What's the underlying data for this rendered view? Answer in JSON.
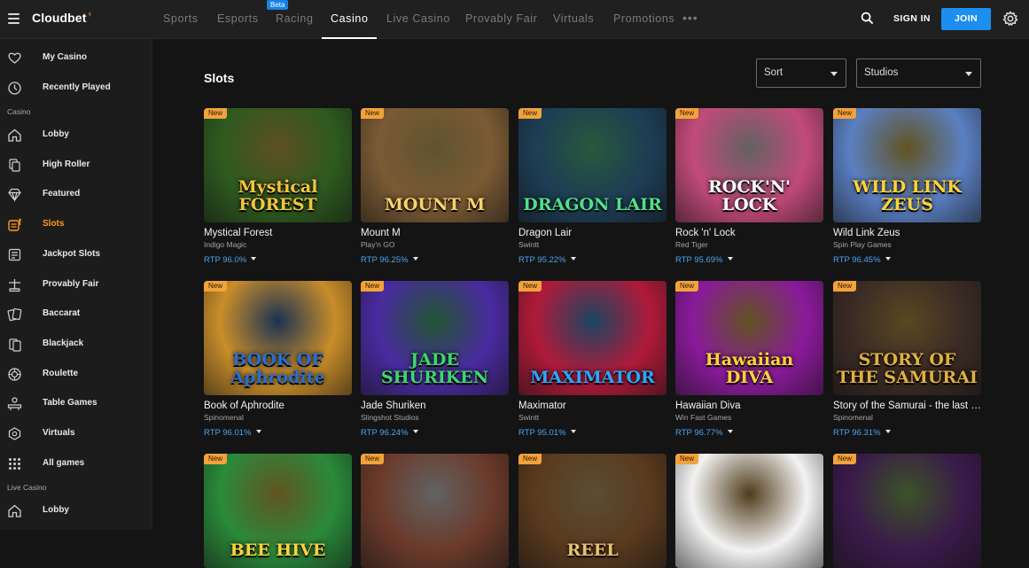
{
  "header": {
    "logo": "Cloudbet",
    "nav": [
      "Sports",
      "Esports",
      "Racing",
      "Casino",
      "Live Casino",
      "Provably Fair",
      "Virtuals",
      "Promotions"
    ],
    "active_nav": "Casino",
    "beta_label": "Beta",
    "more_icon": "more-dots-icon",
    "sign_in": "SIGN IN",
    "join": "JOIN",
    "icons": [
      "hamburger-menu-icon",
      "search-icon",
      "gear-icon"
    ]
  },
  "sidebar": {
    "top_items": [
      {
        "label": "My Casino",
        "icon": "heart-icon"
      },
      {
        "label": "Recently Played",
        "icon": "clock-icon"
      }
    ],
    "casino_section": "Casino",
    "casino_items": [
      {
        "label": "Lobby",
        "icon": "home-icon"
      },
      {
        "label": "High Roller",
        "icon": "chips-icon"
      },
      {
        "label": "Featured",
        "icon": "diamond-icon"
      },
      {
        "label": "Slots",
        "icon": "slot-machine-icon",
        "active": true
      },
      {
        "label": "Jackpot Slots",
        "icon": "jackpot-icon"
      },
      {
        "label": "Provably Fair",
        "icon": "scale-icon"
      },
      {
        "label": "Baccarat",
        "icon": "cards-icon"
      },
      {
        "label": "Blackjack",
        "icon": "blackjack-icon"
      },
      {
        "label": "Roulette",
        "icon": "roulette-icon"
      },
      {
        "label": "Table Games",
        "icon": "table-icon"
      },
      {
        "label": "Virtuals",
        "icon": "virtuals-icon"
      },
      {
        "label": "All games",
        "icon": "grid-icon"
      }
    ],
    "live_section": "Live Casino",
    "live_items": [
      {
        "label": "Lobby",
        "icon": "home-icon"
      }
    ],
    "active_color": "#ff9a1f"
  },
  "main": {
    "title": "Slots",
    "sort_label": "Sort",
    "studios_label": "Studios",
    "new_badge": "New",
    "games": [
      {
        "name": "Mystical Forest",
        "provider": "Indigo Magic",
        "rtp": "RTP 96.0%",
        "art": "Mystical FOREST",
        "bg": "#2e5a1f",
        "accent": "#f2c440"
      },
      {
        "name": "Mount M",
        "provider": "Play'n GO",
        "rtp": "RTP 96.25%",
        "art": "MOUNT M",
        "bg": "#7a5a34",
        "accent": "#f7d36a"
      },
      {
        "name": "Dragon Lair",
        "provider": "Swintt",
        "rtp": "RTP 95.22%",
        "art": "DRAGON LAIR",
        "bg": "#1d3d55",
        "accent": "#4fe08a"
      },
      {
        "name": "Rock 'n' Lock",
        "provider": "Red Tiger",
        "rtp": "RTP 95.69%",
        "art": "ROCK'N' LOCK",
        "bg": "#c24a7a",
        "accent": "#ffffff"
      },
      {
        "name": "Wild Link Zeus",
        "provider": "Spin Play Games",
        "rtp": "RTP 96.45%",
        "art": "WILD LINK ZEUS",
        "bg": "#5a7fc2",
        "accent": "#ffd23a"
      },
      {
        "name": "Book of Aphrodite",
        "provider": "Spinomenal",
        "rtp": "RTP 96.01%",
        "art": "BOOK OF Aphrodite",
        "bg": "#c98d2a",
        "accent": "#2a6fd1"
      },
      {
        "name": "Jade Shuriken",
        "provider": "Slingshot Studios",
        "rtp": "RTP 96.24%",
        "art": "JADE SHURIKEN",
        "bg": "#4a2aa0",
        "accent": "#3bd96b"
      },
      {
        "name": "Maximator",
        "provider": "Swintt",
        "rtp": "RTP 95.01%",
        "art": "MAXIMATOR",
        "bg": "#b01a3a",
        "accent": "#2aa8ff"
      },
      {
        "name": "Hawaiian Diva",
        "provider": "Win Fast Games",
        "rtp": "RTP 96.77%",
        "art": "Hawaiian DIVA",
        "bg": "#8a1a9a",
        "accent": "#ffd23a"
      },
      {
        "name": "Story of the Samurai - the last Ronin",
        "provider": "Spinomenal",
        "rtp": "RTP 96.31%",
        "art": "STORY OF THE SAMURAI",
        "bg": "#3a2a24",
        "accent": "#e0b040"
      },
      {
        "art": "BEE HIVE",
        "bg": "#2a8a3a",
        "accent": "#ffd23a"
      },
      {
        "art": "",
        "bg": "#6a3a2a",
        "accent": "#ffffff"
      },
      {
        "art": "REEL",
        "bg": "#5a3a1e",
        "accent": "#e8c070"
      },
      {
        "art": "",
        "bg": "#f2f2f2",
        "accent": "#c78a2a"
      },
      {
        "art": "",
        "bg": "#3a1a4a",
        "accent": "#8ad04a"
      }
    ]
  }
}
